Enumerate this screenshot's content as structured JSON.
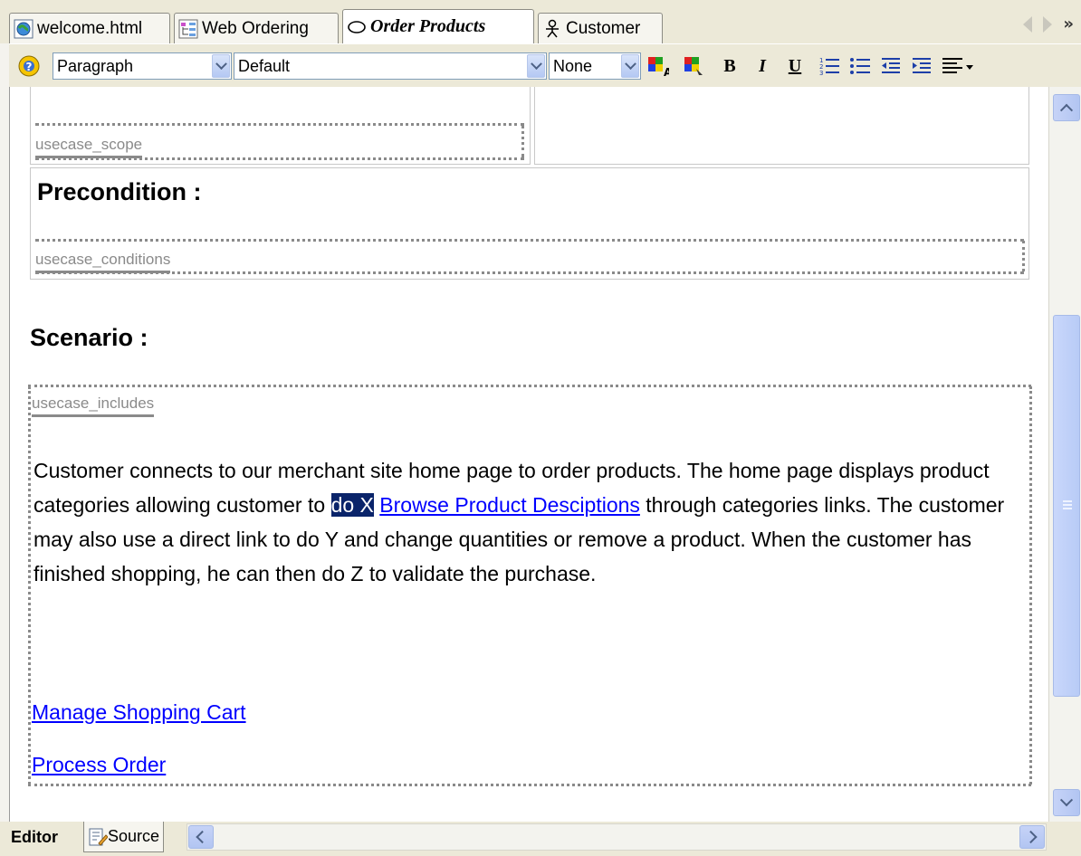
{
  "tabs": [
    {
      "label": "welcome.html",
      "icon": "globe-page-icon"
    },
    {
      "label": "Web Ordering",
      "icon": "diagram-icon"
    },
    {
      "label": "Order Products",
      "icon": "usecase-oval-icon",
      "active": true
    },
    {
      "label": "Customer",
      "icon": "actor-icon"
    }
  ],
  "toolbar": {
    "paragraph_style": "Paragraph",
    "font": "Default",
    "size": "None",
    "bold": "B",
    "italic": "I",
    "underline": "U"
  },
  "document": {
    "scope_field": "usecase_scope",
    "precondition_heading": "Precondition :",
    "conditions_field": "usecase_conditions",
    "scenario_heading": "Scenario :",
    "includes_field": "usecase_includes",
    "para_before": "Customer connects to our merchant site home page to order products. The home page displays product categories allowing customer to ",
    "selected_text": "do X",
    "inline_link": "Browse Product Desciptions",
    "para_after": " through categories links. The customer may also use a direct link to do Y and change quantities or remove a product. When the customer has finished shopping, he can then do Z to validate the purchase.",
    "link_cart": "Manage Shopping Cart",
    "link_order": "Process Order"
  },
  "bottom": {
    "editor_tab": "Editor",
    "source_tab": "Source"
  },
  "colors": {
    "selection": "#0a246a",
    "link": "#0000ff",
    "chrome": "#ece9d8",
    "scrollbar": "#b8cbf6"
  }
}
